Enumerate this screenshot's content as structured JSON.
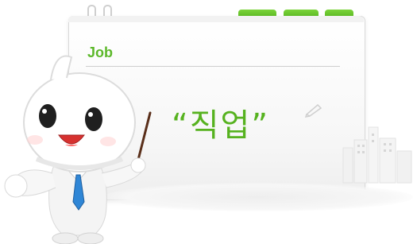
{
  "board": {
    "title": "Job",
    "word": "“직업”"
  },
  "colors": {
    "accent_green": "#5cb82a",
    "tie_blue": "#2f86d6",
    "board_border": "#d9d9d9"
  },
  "icons": [
    "paperclip-icon",
    "pencil-icon",
    "city-buildings-icon",
    "pointer-stick-icon"
  ]
}
